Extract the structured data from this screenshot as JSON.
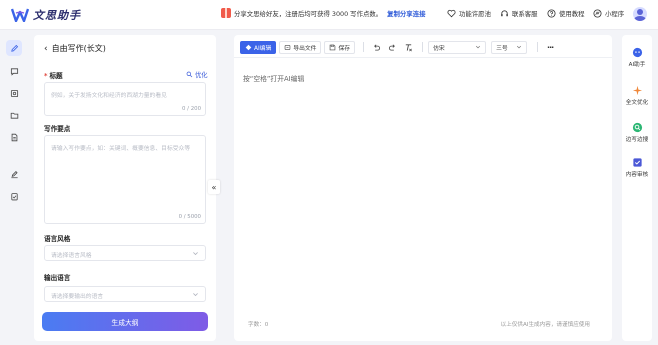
{
  "brand": {
    "name": "文思助手"
  },
  "promo": {
    "text": "分享文思给好友，注册后均可获得 3000 写作点数。",
    "link": "复制分享连接"
  },
  "nav": {
    "feature_requests": "功能许愿池",
    "support": "联系客服",
    "tutorial": "使用教程",
    "mini_program": "小程序"
  },
  "panel": {
    "title": "自由写作(长文)",
    "title_field": {
      "label": "标题",
      "optimize": "优化",
      "placeholder": "例如，关于发扬文化和经济的西湖力量的看见",
      "counter": "0 / 200"
    },
    "points_field": {
      "label": "写作要点",
      "placeholder": "请输入写作要点，如：关键词、概要信息、目标受众等",
      "counter": "0 / 5000"
    },
    "style_field": {
      "label": "语言风格",
      "placeholder": "请选择语言风格"
    },
    "language_field": {
      "label": "输出语言",
      "placeholder": "请选择要输出的语言"
    },
    "generate_button": "生成大纲"
  },
  "collapse_glyph": "«",
  "editor": {
    "toolbar": {
      "ai_edit": "AI编辑",
      "export": "导出文件",
      "save": "保存",
      "font": "仿宋",
      "size": "三号",
      "more": "···"
    },
    "placeholder": "按“空格”打开AI编辑",
    "word_count": "字数：0",
    "disclaimer": "以上仅供AI生成内容，请谨慎应使用"
  },
  "right_panel": {
    "items": [
      {
        "label": "AI助手",
        "icon": "ai-assistant-icon",
        "color": "#3b63e8"
      },
      {
        "label": "全文优化",
        "icon": "sparkle-icon",
        "color": "#f0883a"
      },
      {
        "label": "边写边搜",
        "icon": "search-write-icon",
        "color": "#2bb673"
      },
      {
        "label": "内容审核",
        "icon": "review-icon",
        "color": "#4b58d6"
      }
    ]
  },
  "colors": {
    "accent": "#3b63e8",
    "gradient_start": "#4a7cf2",
    "gradient_end": "#7f5be6",
    "brand_dark": "#2d2f6e"
  }
}
